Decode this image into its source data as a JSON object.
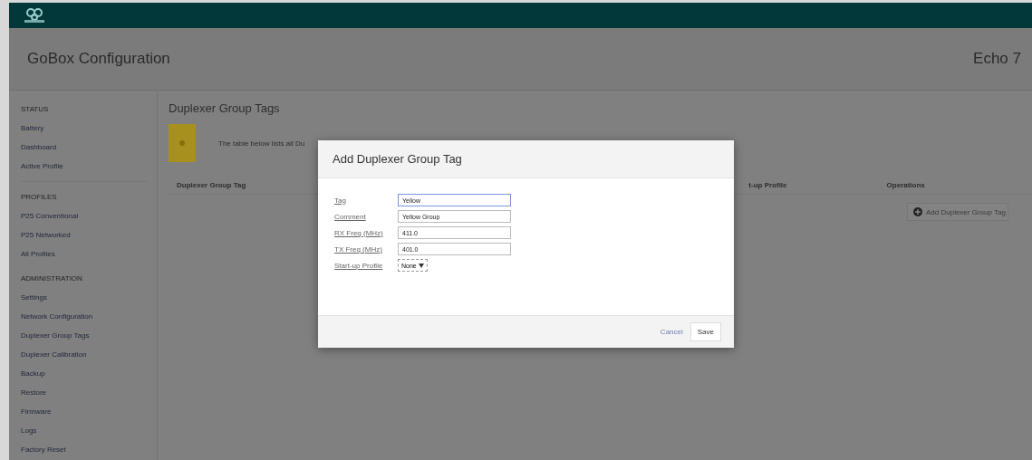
{
  "header": {
    "title": "GoBox Configuration",
    "device": "Echo 7"
  },
  "sidebar": {
    "sections": [
      {
        "heading": "STATUS",
        "items": [
          "Battery",
          "Dashboard",
          "Active Profile"
        ]
      },
      {
        "heading": "PROFILES",
        "items": [
          "P25 Conventional",
          "P25 Networked",
          "All Profiles"
        ]
      },
      {
        "heading": "ADMINISTRATION",
        "items": [
          "Settings",
          "Network Configuration",
          "Duplexer Group Tags",
          "Duplexer Calibration",
          "Backup",
          "Restore",
          "Firmware",
          "Logs",
          "Factory Reset"
        ]
      }
    ]
  },
  "page": {
    "title": "Duplexer Group Tags",
    "info": "The table below lists all Du",
    "columns": [
      "Duplexer Group Tag",
      "t-up Profile",
      "Operations"
    ],
    "add_button": "Add Duplexer Group Tag"
  },
  "dialog": {
    "title": "Add Duplexer Group Tag",
    "fields": [
      {
        "label": "Tag",
        "kind": "text",
        "value": "Yellow",
        "focused": true
      },
      {
        "label": "Comment",
        "kind": "text",
        "value": "Yellow Group",
        "focused": false
      },
      {
        "label": "RX Freq (MHz)",
        "kind": "text",
        "value": "411.0",
        "focused": false
      },
      {
        "label": "TX Freq (MHz)",
        "kind": "text",
        "value": "401.0",
        "focused": false
      },
      {
        "label": "Start-up Profile",
        "kind": "select",
        "value": "None",
        "focused": false
      }
    ],
    "cancel": "Cancel",
    "save": "Save"
  }
}
